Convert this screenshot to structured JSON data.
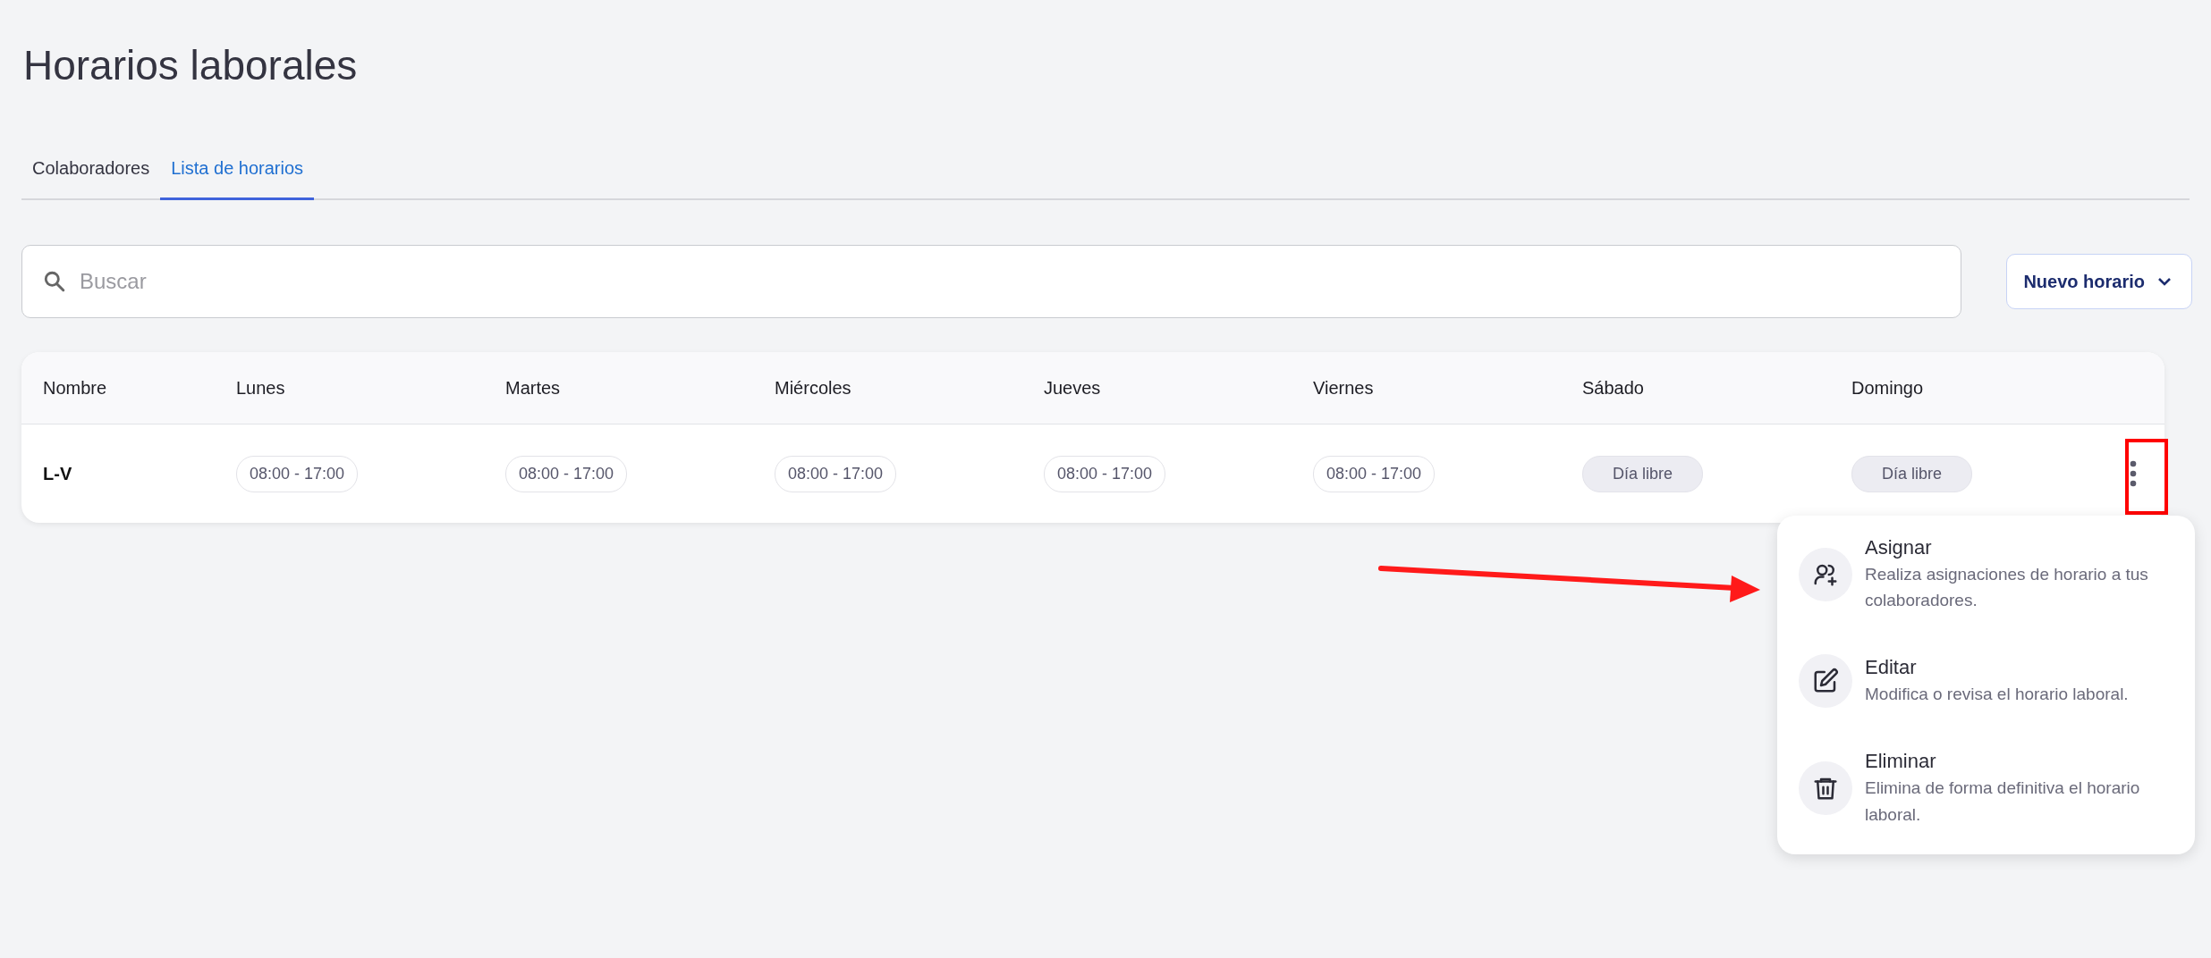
{
  "page": {
    "title": "Horarios laborales"
  },
  "tabs": [
    {
      "label": "Colaboradores",
      "selected": false
    },
    {
      "label": "Lista de horarios",
      "selected": true
    }
  ],
  "search": {
    "placeholder": "Buscar"
  },
  "new_button": {
    "label": "Nuevo horario"
  },
  "table": {
    "columns": [
      "Nombre",
      "Lunes",
      "Martes",
      "Miércoles",
      "Jueves",
      "Viernes",
      "Sábado",
      "Domingo"
    ],
    "rows": [
      {
        "cells": [
          {
            "kind": "name",
            "text": "L-V"
          },
          {
            "kind": "time",
            "text": "08:00 - 17:00"
          },
          {
            "kind": "time",
            "text": "08:00 - 17:00"
          },
          {
            "kind": "time",
            "text": "08:00 - 17:00"
          },
          {
            "kind": "time",
            "text": "08:00 - 17:00"
          },
          {
            "kind": "time",
            "text": "08:00 - 17:00"
          },
          {
            "kind": "off",
            "text": "Día libre"
          },
          {
            "kind": "off",
            "text": "Día libre"
          }
        ]
      }
    ]
  },
  "row_menu": {
    "items": [
      {
        "kind": "assign",
        "title": "Asignar",
        "description": "Realiza asignaciones de horario a tus colaboradores."
      },
      {
        "kind": "edit",
        "title": "Editar",
        "description": "Modifica o revisa el horario laboral."
      },
      {
        "kind": "delete",
        "title": "Eliminar",
        "description": "Elimina de forma definitiva el horario laboral."
      }
    ]
  }
}
